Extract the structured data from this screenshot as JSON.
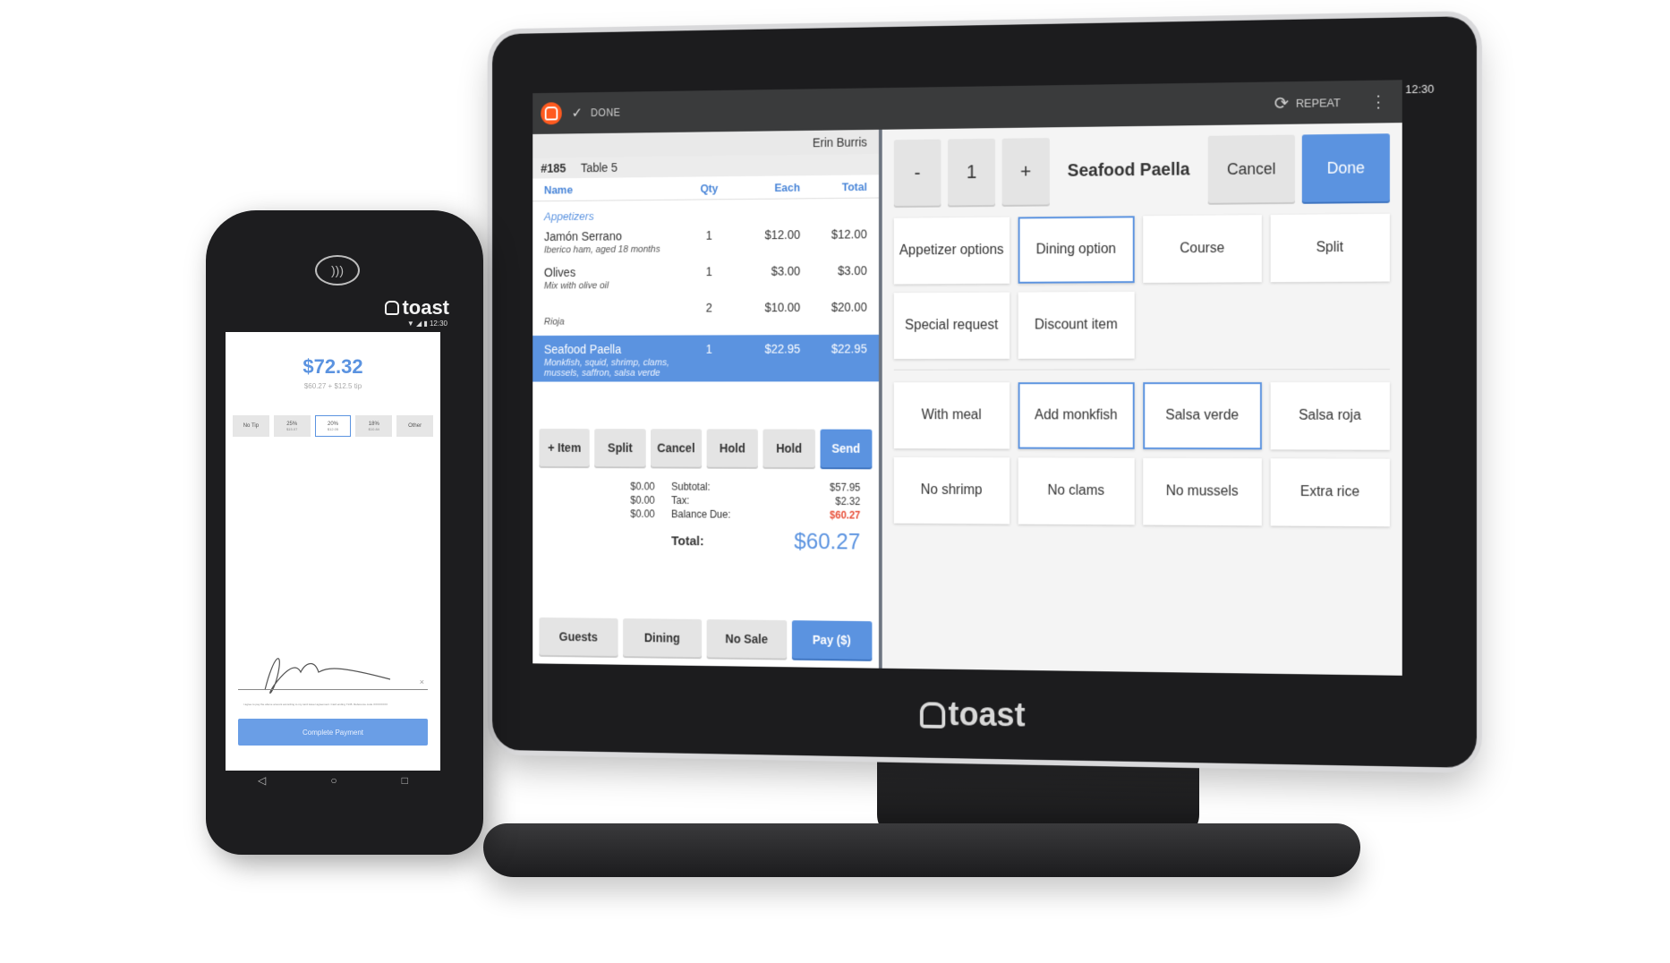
{
  "monitor": {
    "status_bar": {
      "wifi_icon": "wifi-icon",
      "signal_icon": "signal-icon",
      "battery_icon": "battery-icon",
      "time": "12:30"
    },
    "topbar": {
      "done_label": "DONE",
      "repeat_label": "REPEAT"
    },
    "order": {
      "server": "Erin Burris",
      "ticket_number": "#185",
      "table": "Table 5",
      "columns": {
        "name": "Name",
        "qty": "Qty",
        "each": "Each",
        "total": "Total"
      },
      "section": "Appetizers",
      "items": [
        {
          "name": "Jamón Serrano",
          "desc": "Iberico ham, aged 18 months",
          "qty": "1",
          "each": "$12.00",
          "total": "$12.00"
        },
        {
          "name": "Olives",
          "desc": "Mix with olive oil",
          "qty": "1",
          "each": "$3.00",
          "total": "$3.00"
        },
        {
          "name": "",
          "desc": "Rioja",
          "qty": "2",
          "each": "$10.00",
          "total": "$20.00"
        },
        {
          "name": "Seafood Paella",
          "desc": "Monkfish, squid, shrimp, clams, mussels, saffron, salsa verde",
          "qty": "1",
          "each": "$22.95",
          "total": "$22.95",
          "selected": true
        }
      ],
      "actions": [
        "+ Item",
        "Split",
        "Cancel",
        "Hold",
        "Hold",
        "Send"
      ],
      "left_totals": [
        "$0.00",
        "$0.00",
        "$0.00"
      ],
      "subtotal_label": "Subtotal:",
      "subtotal": "$57.95",
      "tax_label": "Tax:",
      "tax": "$2.32",
      "balance_label": "Balance Due:",
      "balance": "$60.27",
      "total_label": "Total:",
      "total": "$60.27",
      "bottom_actions": [
        "Guests",
        "Dining",
        "No Sale",
        "Pay ($)"
      ]
    },
    "modifier": {
      "minus": "-",
      "quantity": "1",
      "plus": "+",
      "item_title": "Seafood Paella",
      "cancel": "Cancel",
      "done": "Done",
      "options_row1": [
        {
          "label": "Appetizer options",
          "selected": false
        },
        {
          "label": "Dining option",
          "selected": true
        },
        {
          "label": "Course",
          "selected": false
        },
        {
          "label": "Split",
          "selected": false
        }
      ],
      "options_row2": [
        {
          "label": "Special request",
          "selected": false
        },
        {
          "label": "Discount item",
          "selected": false
        }
      ],
      "modifiers": [
        {
          "label": "With meal",
          "selected": false
        },
        {
          "label": "Add monkfish",
          "selected": true
        },
        {
          "label": "Salsa verde",
          "selected": true
        },
        {
          "label": "Salsa roja",
          "selected": false
        },
        {
          "label": "No shrimp",
          "selected": false
        },
        {
          "label": "No clams",
          "selected": false
        },
        {
          "label": "No mussels",
          "selected": false
        },
        {
          "label": "Extra rice",
          "selected": false
        }
      ]
    },
    "brand": "toast"
  },
  "handheld": {
    "brand": "toast",
    "time": "12:30",
    "amount": "$72.32",
    "amount_breakdown": "$60.27 + $12.5 tip",
    "tips": [
      {
        "label": "No Tip",
        "sub": "",
        "selected": false
      },
      {
        "label": "25%",
        "sub": "$15.07",
        "selected": false
      },
      {
        "label": "20%",
        "sub": "$12.05",
        "selected": true
      },
      {
        "label": "18%",
        "sub": "$10.84",
        "selected": false
      },
      {
        "label": "Other",
        "sub": "",
        "selected": false
      }
    ],
    "legal_text": "I agree to pay the above amount according to my card issuer agreement. Card ending 7135. Reference code XXXXXXXX",
    "complete_button": "Complete Payment",
    "nav": {
      "back": "◁",
      "home": "○",
      "recent": "□"
    }
  },
  "colors": {
    "accent": "#5b93e0",
    "brand_orange": "#ff5a1f",
    "due_red": "#e8503a"
  }
}
